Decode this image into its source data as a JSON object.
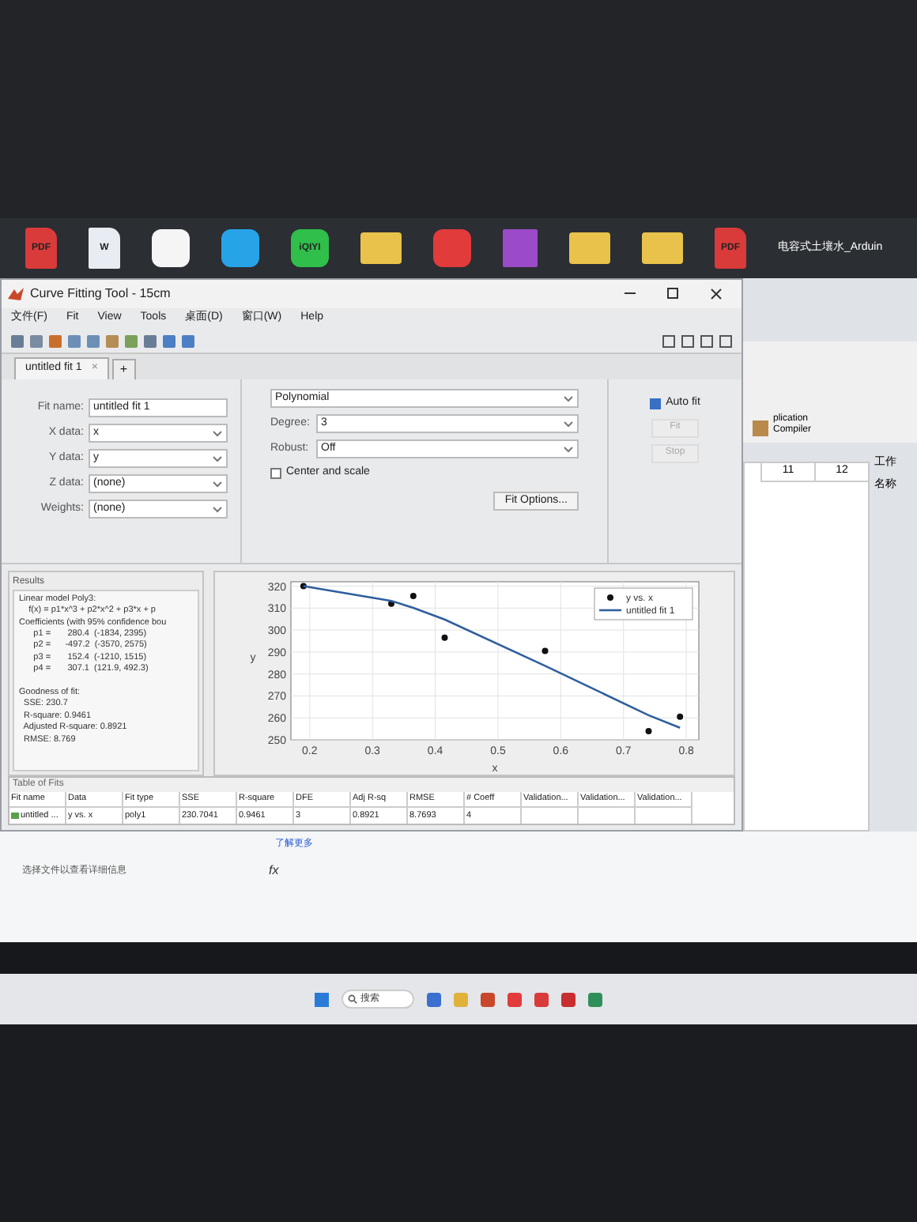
{
  "desktop": {
    "icons": [
      {
        "kind": "pdf",
        "label": "PDF",
        "color": "#d93a3a"
      },
      {
        "kind": "doc",
        "label": "W",
        "color": "#e8ecf3"
      },
      {
        "kind": "app",
        "color": "#f5f5f5"
      },
      {
        "kind": "app",
        "color": "#27a4e8"
      },
      {
        "kind": "app",
        "label": "iQIYI",
        "color": "#2fbf4a"
      },
      {
        "kind": "folder",
        "color": "#e8c24a"
      },
      {
        "kind": "app",
        "color": "#e23b3b"
      },
      {
        "kind": "archive",
        "color": "#9b4ac8"
      },
      {
        "kind": "folder",
        "color": "#e8c24a"
      },
      {
        "kind": "folder",
        "color": "#e8c24a"
      },
      {
        "kind": "pdf",
        "label": "PDF",
        "color": "#d93a3a"
      }
    ],
    "caption": "电容式土壤水_Arduin"
  },
  "window": {
    "title": "Curve Fitting Tool - 15cm",
    "menu": [
      "文件(F)",
      "Fit",
      "View",
      "Tools",
      "桌面(D)",
      "窗口(W)",
      "Help"
    ],
    "tabs": [
      {
        "label": "untitled fit 1",
        "close": "×",
        "selected": true
      }
    ],
    "new_tab": "+",
    "fields": [
      {
        "kind": "text",
        "label": "Fit name:",
        "value": "untitled fit 1"
      },
      {
        "kind": "select",
        "label": "X data:",
        "value": "x"
      },
      {
        "kind": "select",
        "label": "Y data:",
        "value": "y"
      },
      {
        "kind": "select",
        "label": "Z data:",
        "value": "(none)"
      },
      {
        "kind": "select",
        "label": "Weights:",
        "value": "(none)"
      }
    ],
    "fit_type": "Polynomial",
    "options": [
      {
        "label": "Degree:",
        "value": "3"
      },
      {
        "label": "Robust:",
        "value": "Off"
      }
    ],
    "center_and_scale": {
      "label": "Center and scale",
      "checked": false
    },
    "fit_options": "Fit Options...",
    "auto_fit": {
      "label": "Auto fit",
      "checked": true
    },
    "actions": [
      {
        "label": "Fit",
        "disabled": true
      },
      {
        "label": "Stop",
        "disabled": true
      }
    ],
    "results": {
      "title": "Results",
      "sections": [
        [
          "Linear model Poly3:",
          "    f(x) = p1*x^3 + p2*x^2 + p3*x + p",
          "Coefficients (with 95% confidence bou",
          "      p1 =       280.4  (-1834, 2395)",
          "      p2 =      -497.2  (-3570, 2575)",
          "      p3 =       152.4  (-1210, 1515)",
          "      p4 =       307.1  (121.9, 492.3)"
        ],
        [
          "Goodness of fit:",
          "  SSE: 230.7",
          "  R-square: 0.9461",
          "  Adjusted R-square: 0.8921",
          "  RMSE: 8.769"
        ]
      ]
    },
    "chart_data": {
      "type": "scatter",
      "xlabel": "x",
      "ylabel": "y",
      "grid": true,
      "legend": "upper right",
      "x": [
        0.19,
        0.33,
        0.365,
        0.415,
        0.575,
        0.74,
        0.79
      ],
      "series": [
        {
          "name": "y vs. x",
          "type": "scatter",
          "color": "#111111",
          "values": [
            320,
            312,
            315.5,
            296.5,
            290.5,
            254,
            260.5
          ]
        },
        {
          "name": "untitled fit 1",
          "type": "line",
          "color": "#2f5f9e",
          "values": [
            320,
            313.3,
            310.1,
            304.8,
            283.7,
            261.2,
            255.5
          ]
        }
      ],
      "xlim": [
        0.17,
        0.82
      ],
      "ylim": [
        250,
        322
      ],
      "xticks": [
        0.2,
        0.3,
        0.4,
        0.5,
        0.6,
        0.7,
        0.8
      ],
      "yticks": [
        250,
        260,
        270,
        280,
        290,
        300,
        310,
        320
      ]
    },
    "table": {
      "title": "Table of Fits",
      "columns": [
        "Fit name",
        "Data",
        "Fit type",
        "SSE",
        "R-square",
        "DFE",
        "Adj R-sq",
        "RMSE",
        "# Coeff",
        "Validation...",
        "Validation...",
        "Validation..."
      ],
      "rows": [
        [
          "untitled ...",
          "y vs. x",
          "poly1",
          "230.7041",
          "0.9461",
          "3",
          "0.8921",
          "8.7693",
          "4",
          "",
          "",
          ""
        ]
      ]
    }
  },
  "background": {
    "toolstrip": "plication\nCompiler",
    "columns": [
      "11",
      "12"
    ],
    "workspace": [
      "工作",
      "名称"
    ],
    "learn_more": "了解更多",
    "prompt": "fx",
    "hint": "选择文件以查看详细信息"
  },
  "taskbar": {
    "search": "搜索"
  }
}
